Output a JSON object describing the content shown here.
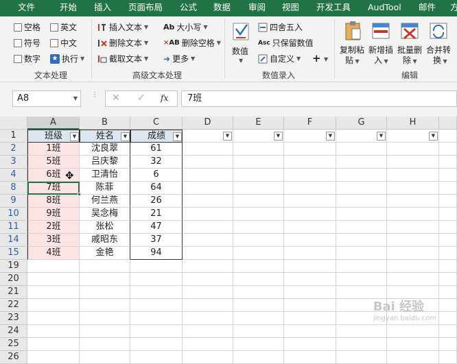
{
  "menu": [
    "文件",
    "开始",
    "插入",
    "页面布局",
    "公式",
    "数据",
    "审阅",
    "视图",
    "开发工具",
    "AudTool",
    "邮件",
    "方"
  ],
  "ribbon": {
    "text_group": {
      "label": "文本处理",
      "checks": [
        "空格",
        "符号",
        "数字",
        "英文",
        "中文"
      ],
      "execute": "执行"
    },
    "adv_group": {
      "label": "高级文本处理",
      "items": [
        "插入文本",
        "删除文本",
        "截取文本",
        "大小写",
        "删除空格",
        "更多"
      ]
    },
    "num_group": {
      "label": "数值录入",
      "big_button": "数值",
      "items": [
        "四舍五入",
        "只保留数值",
        "自定义"
      ]
    },
    "edit_group": {
      "label": "编辑",
      "buttons": [
        {
          "line1": "复制粘",
          "line2": "贴"
        },
        {
          "line1": "新增插",
          "line2": "入"
        },
        {
          "line1": "批量删",
          "line2": "除"
        },
        {
          "line1": "合并转",
          "line2": "换"
        }
      ]
    }
  },
  "formula_bar": {
    "name_box": "A8",
    "fx": "fx",
    "formula": "7班"
  },
  "sheet": {
    "columns": [
      "A",
      "B",
      "C",
      "D",
      "E",
      "F",
      "G",
      "H"
    ],
    "headers": [
      "班级",
      "姓名",
      "成绩"
    ],
    "rows": [
      {
        "num": "2",
        "class": "1班",
        "name": "沈良翠",
        "score": "61"
      },
      {
        "num": "3",
        "class": "5班",
        "name": "吕庆黎",
        "score": "32"
      },
      {
        "num": "4",
        "class": "6班",
        "name": "卫清怡",
        "score": "6"
      },
      {
        "num": "8",
        "class": "7班",
        "name": "陈菲",
        "score": "64"
      },
      {
        "num": "9",
        "class": "8班",
        "name": "何兰燕",
        "score": "26"
      },
      {
        "num": "10",
        "class": "9班",
        "name": "吴念梅",
        "score": "21"
      },
      {
        "num": "11",
        "class": "2班",
        "name": "张松",
        "score": "47"
      },
      {
        "num": "14",
        "class": "3班",
        "name": "戚昭东",
        "score": "37"
      },
      {
        "num": "15",
        "class": "4班",
        "name": "金艳",
        "score": "94"
      }
    ],
    "empty_rows": [
      "19",
      "20",
      "21",
      "22",
      "23",
      "24",
      "25",
      "26"
    ]
  },
  "watermark": {
    "text": "Bai 经验",
    "sub": "jingyan.baidu.com"
  },
  "colors": {
    "accent": "#217346",
    "class_fill": "#fce4e4",
    "header_fill": "#dce6f1",
    "selection": "#217346"
  }
}
